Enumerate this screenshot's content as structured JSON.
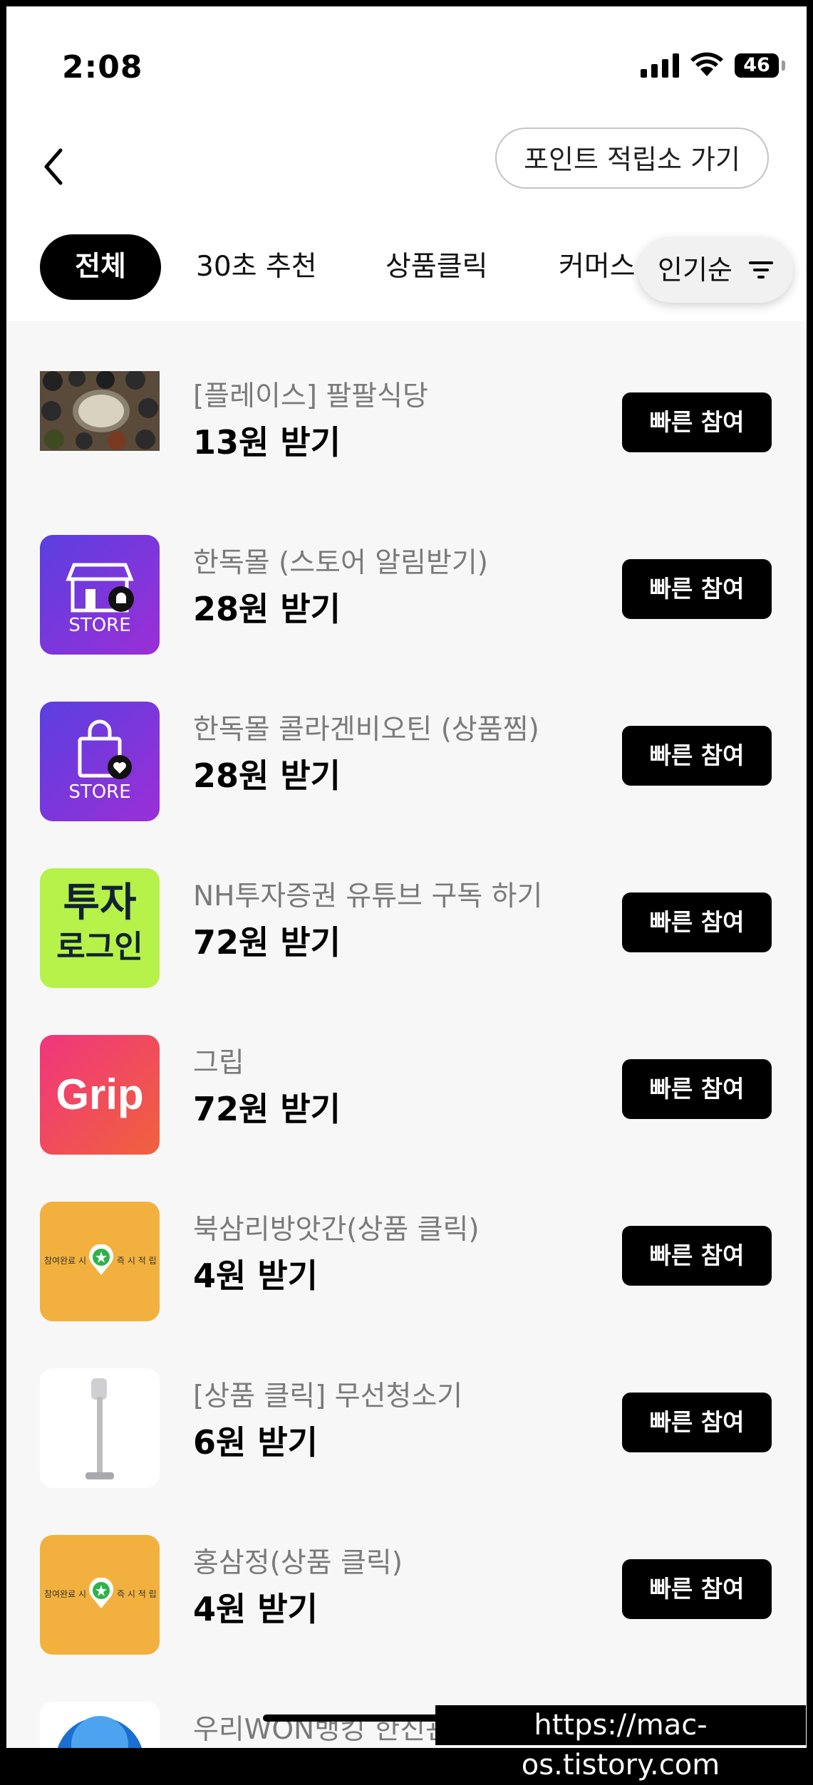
{
  "status_bar": {
    "time": "2:08",
    "battery": "46"
  },
  "header": {
    "point_store_button": "포인트 적립소 가기"
  },
  "tabs": [
    {
      "label": "전체"
    },
    {
      "label": "30초 추천"
    },
    {
      "label": "상품클릭"
    },
    {
      "label": "커머스"
    }
  ],
  "sort": {
    "label": "인기순"
  },
  "items": [
    {
      "title": "[플레이스] 팔팔식당",
      "reward": "13원 받기",
      "button": "빠른 참여"
    },
    {
      "title": "한독몰 (스토어 알림받기)",
      "reward": "28원 받기",
      "button": "빠른 참여",
      "icon_text": "STORE"
    },
    {
      "title": "한독몰 콜라겐비오틴 (상품찜)",
      "reward": "28원 받기",
      "button": "빠른 참여",
      "icon_text": "STORE"
    },
    {
      "title": "NH투자증권 유튜브 구독 하기",
      "reward": "72원 받기",
      "button": "빠른 참여",
      "icon_text_1": "투자",
      "icon_text_2": "로그인"
    },
    {
      "title": "그립",
      "reward": "72원 받기",
      "button": "빠른 참여",
      "icon_text": "Grip"
    },
    {
      "title": "북삼리방앗간(상품 클릭)",
      "reward": "4원 받기",
      "button": "빠른 참여",
      "icon_text_left": "참여완료 시",
      "icon_text_right": "즉 시 적 립"
    },
    {
      "title": "[상품 클릭] 무선청소기",
      "reward": "6원 받기",
      "button": "빠른 참여"
    },
    {
      "title": "홍삼정(상품 클릭)",
      "reward": "4원 받기",
      "button": "빠른 참여",
      "icon_text_left": "참여완료 시",
      "icon_text_right": "즉 시 적 립"
    },
    {
      "title": "우리WON뱅킹 한진관"
    }
  ],
  "watermark": "https://mac-os.tistory.com",
  "colors": {
    "store_gradient_start": "#5a3fe0",
    "store_gradient_end": "#9b2fd6",
    "nh_bg": "#b6f24a",
    "grip_start": "#f0357e",
    "grip_end": "#f0623c",
    "coupon_bg": "#f2b13e"
  }
}
